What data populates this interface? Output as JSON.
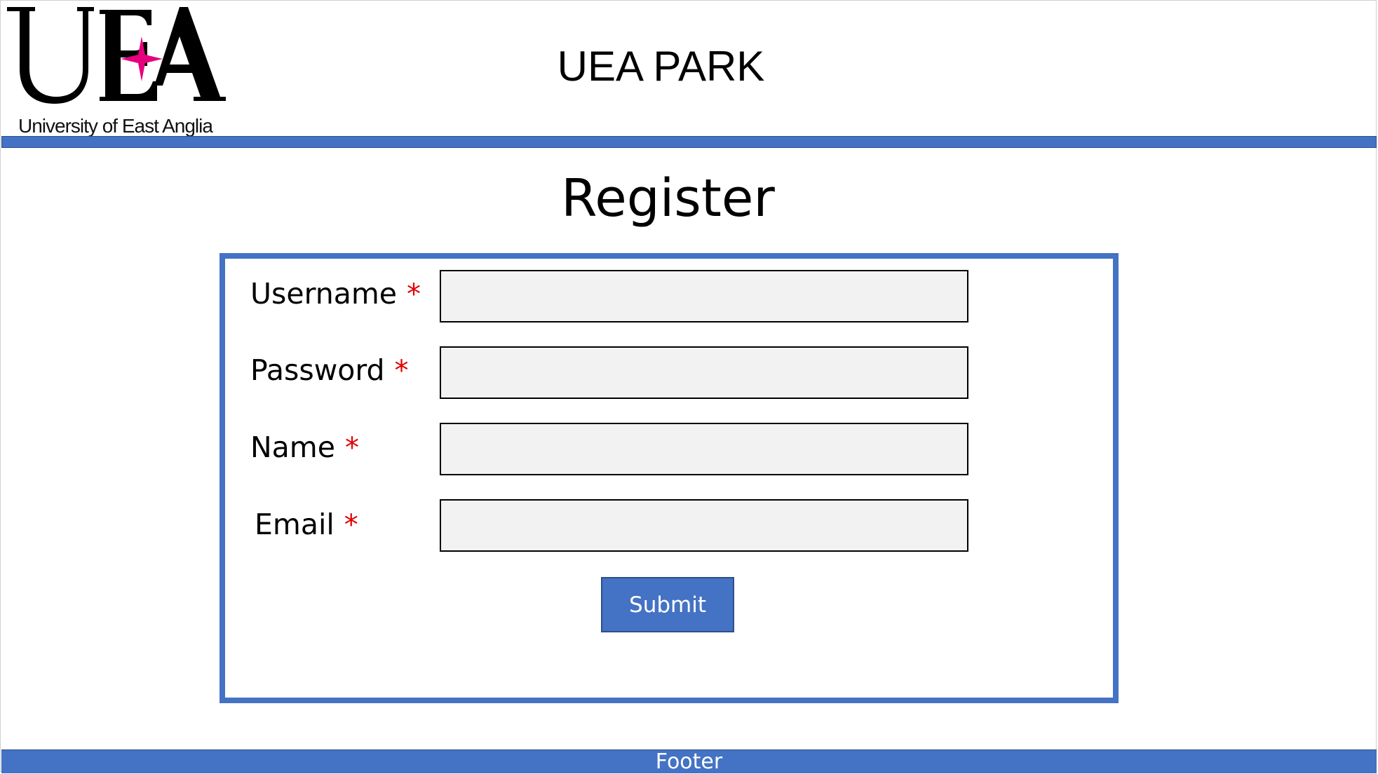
{
  "header": {
    "logo": {
      "mark_text": "UEA",
      "caption": "University of East Anglia",
      "star_color": "#e6007e"
    },
    "site_title": "UEA PARK"
  },
  "main": {
    "heading": "Register",
    "form": {
      "fields": [
        {
          "label": "Username",
          "required_mark": "*",
          "value": "",
          "placeholder": ""
        },
        {
          "label": "Password",
          "required_mark": "*",
          "value": "",
          "placeholder": ""
        },
        {
          "label": "Name",
          "required_mark": "*",
          "value": "",
          "placeholder": ""
        },
        {
          "label": "Email",
          "required_mark": "*",
          "value": "",
          "placeholder": ""
        }
      ],
      "submit_label": "Submit"
    }
  },
  "footer": {
    "text": "Footer"
  },
  "colors": {
    "accent": "#4472c4",
    "required": "#e00000",
    "input_background": "#f2f2f2"
  }
}
